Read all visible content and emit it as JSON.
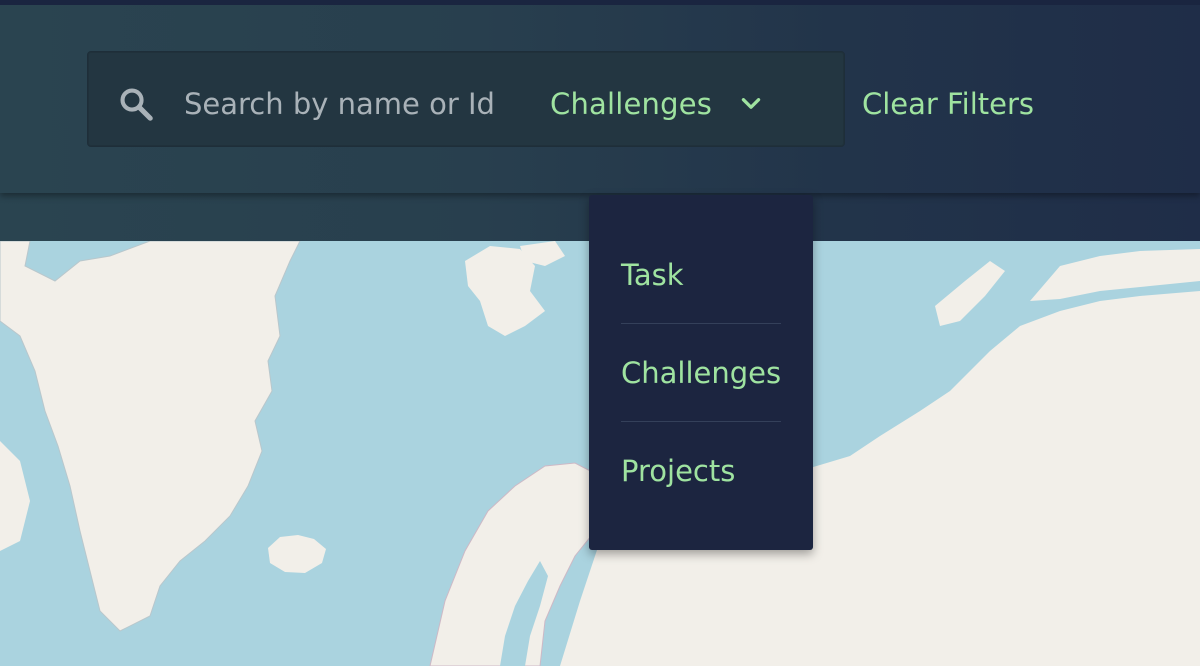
{
  "search": {
    "placeholder": "Search by name or Id",
    "type_label": "Challenges"
  },
  "actions": {
    "clear_filters": "Clear Filters"
  },
  "dropdown": {
    "items": [
      {
        "label": "Task"
      },
      {
        "label": "Challenges"
      },
      {
        "label": "Projects"
      }
    ]
  },
  "icons": {
    "search": "search-icon",
    "chevron": "chevron-down-icon"
  },
  "colors": {
    "accent": "#9fe3a0",
    "header": "#283f4e",
    "dropdown_bg": "#1c2540",
    "water": "#aad3df",
    "land": "#f2efe9"
  }
}
